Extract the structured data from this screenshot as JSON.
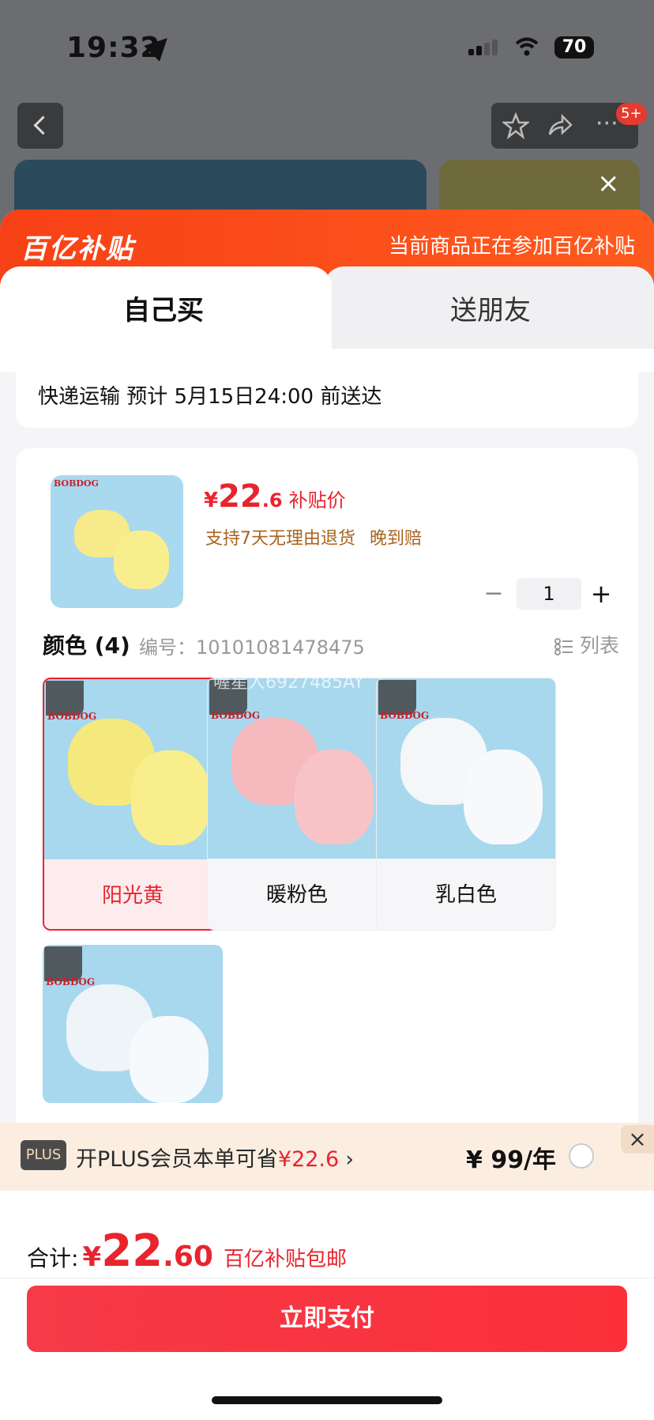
{
  "status_bar": {
    "time": "19:32",
    "battery": "70"
  },
  "nav": {
    "badge": "5+"
  },
  "sheet": {
    "logo": "百亿补贴",
    "head_note": "当前商品正在参加百亿补贴",
    "tabs": [
      {
        "label": "自己买"
      },
      {
        "label": "送朋友"
      }
    ],
    "delivery": "快递运输 预计 5月15日24:00 前送达"
  },
  "product": {
    "brand": "BOBDOG",
    "yen": "¥",
    "price_int": "22",
    "price_dec": ".6",
    "price_label": "补贴价",
    "perks": [
      "支持7天无理由退货",
      "晚到赔"
    ],
    "quantity": "1"
  },
  "colors": {
    "title": "颜色 (4)",
    "sku": "编号：10101081478475",
    "list_label": "列表",
    "watermark": "喔星人6927485AY",
    "items": [
      {
        "name": "阳光黄",
        "selected": true
      },
      {
        "name": "暖粉色",
        "selected": false
      },
      {
        "name": "乳白色",
        "selected": false
      },
      {
        "name": "",
        "selected": false
      }
    ]
  },
  "plus": {
    "badge": "PLUS",
    "text_prefix": "开PLUS会员本单可省",
    "text_amount": "¥22.6",
    "arrow": "›",
    "price": "¥ 99/年",
    "close": "×"
  },
  "footer": {
    "total_label": "合计:",
    "yen": "¥",
    "total_int": "22",
    "total_dec": ".60",
    "note": "百亿补贴包邮",
    "pay_label": "立即支付"
  }
}
